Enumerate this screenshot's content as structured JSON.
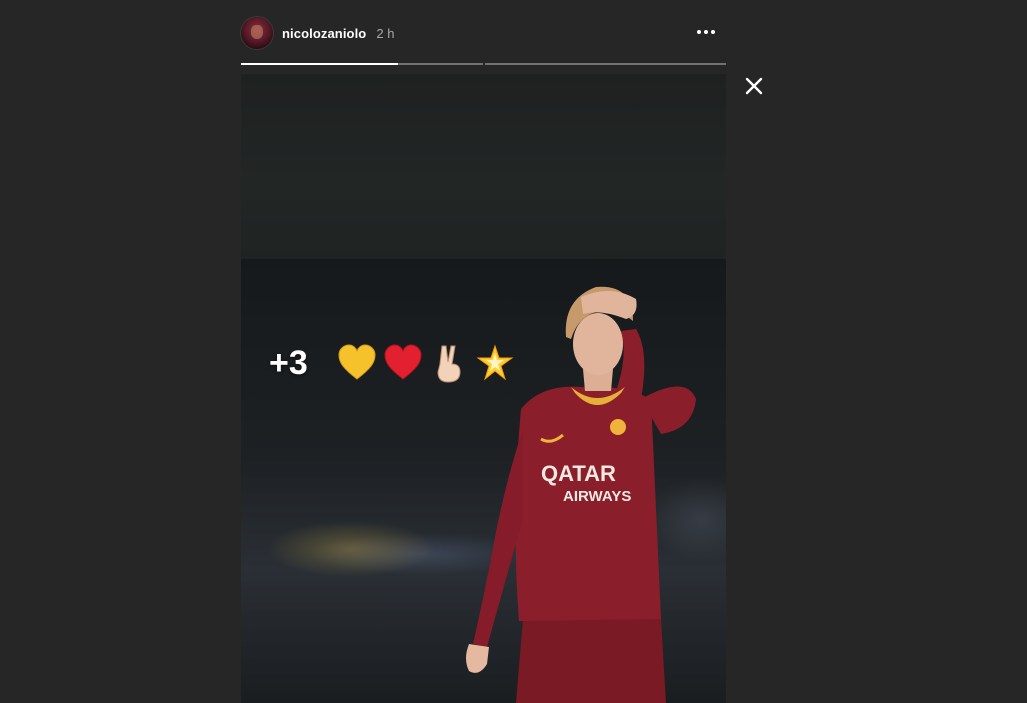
{
  "story": {
    "username": "nicolozaniolo",
    "time": "2 h",
    "caption_text": "+3",
    "emojis": [
      "yellow-heart",
      "red-heart",
      "victory-hand",
      "glowing-star"
    ],
    "progress": [
      {
        "fraction": 0.65
      },
      {
        "fraction": 0.0
      }
    ]
  },
  "colors": {
    "background": "#262626",
    "text": "#ffffff",
    "muted": "#a8a8a8",
    "shirt": "#8b1e2b"
  },
  "icons": {
    "more": "more-options-icon",
    "close": "close-icon"
  }
}
